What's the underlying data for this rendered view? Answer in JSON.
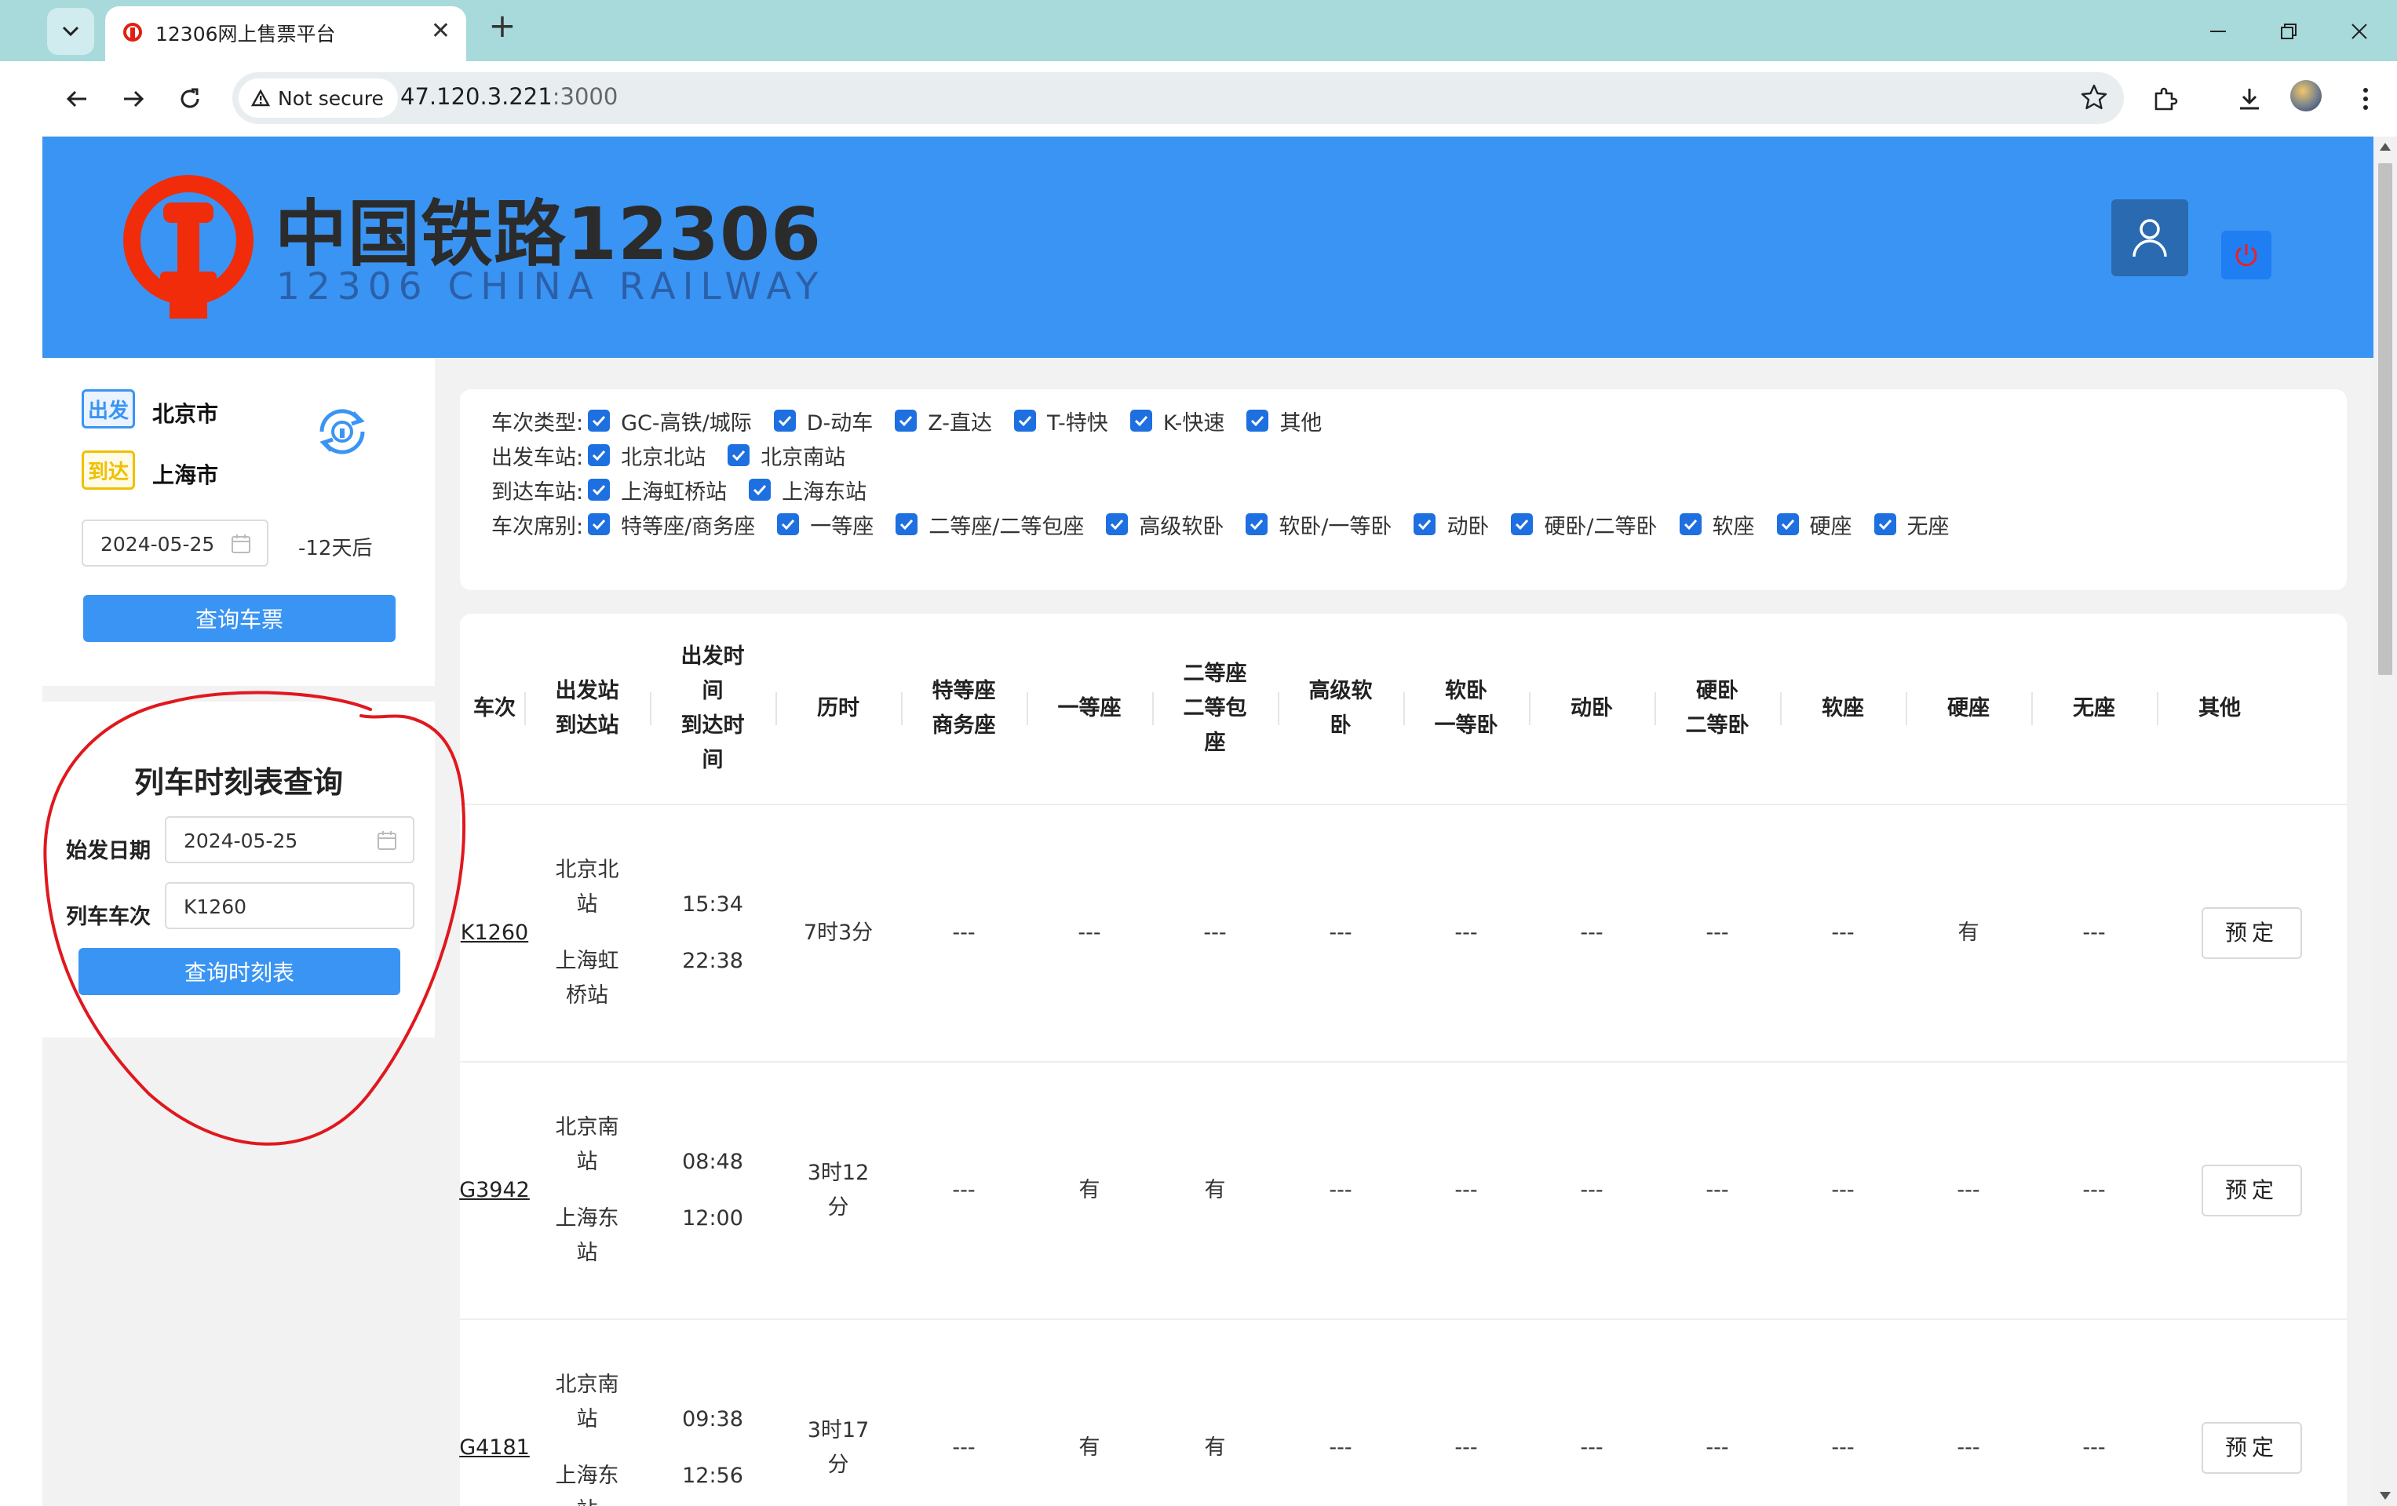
{
  "browser": {
    "tab_title": "12306网上售票平台",
    "security_label": "Not secure",
    "url_host": "47.120.3.221",
    "url_port": ":3000"
  },
  "header": {
    "logo_title": "中国铁路12306",
    "logo_subtitle": "12306 CHINA RAILWAY",
    "brand_color": "#3a94f3"
  },
  "search": {
    "depart_tag": "出发",
    "depart_city": "北京市",
    "arrive_tag": "到达",
    "arrive_city": "上海市",
    "date": "2024-05-25",
    "days_later": "-12天后",
    "query_button": "查询车票"
  },
  "timetable": {
    "title": "列车时刻表查询",
    "date_label": "始发日期",
    "date_value": "2024-05-25",
    "train_label": "列车车次",
    "train_value": "K1260",
    "query_button": "查询时刻表"
  },
  "filters": {
    "train_type_label": "车次类型:",
    "train_types": [
      "GC-高铁/城际",
      "D-动车",
      "Z-直达",
      "T-特快",
      "K-快速",
      "其他"
    ],
    "depart_station_label": "出发车站:",
    "depart_stations": [
      "北京北站",
      "北京南站"
    ],
    "arrive_station_label": "到达车站:",
    "arrive_stations": [
      "上海虹桥站",
      "上海东站"
    ],
    "seat_label": "车次席别:",
    "seats": [
      "特等座/商务座",
      "一等座",
      "二等座/二等包座",
      "高级软卧",
      "软卧/一等卧",
      "动卧",
      "硬卧/二等卧",
      "软座",
      "硬座",
      "无座"
    ]
  },
  "table": {
    "headers": {
      "train_no": "车次",
      "stations_1": "出发站",
      "stations_2": "到达站",
      "time_1": "出发时",
      "time_2": "间",
      "time_3": "到达时",
      "time_4": "间",
      "duration": "历时",
      "business_1": "特等座",
      "business_2": "商务座",
      "first": "一等座",
      "second_1": "二等座",
      "second_2": "二等包",
      "second_3": "座",
      "deluxe_1": "高级软",
      "deluxe_2": "卧",
      "soft_sleeper_1": "软卧",
      "soft_sleeper_2": "一等卧",
      "moving_sleeper": "动卧",
      "hard_sleeper_1": "硬卧",
      "hard_sleeper_2": "二等卧",
      "soft_seat": "软座",
      "hard_seat": "硬座",
      "no_seat": "无座",
      "other": "其他"
    },
    "rows": [
      {
        "train_no": "K1260",
        "from_1": "北京北",
        "from_2": "站",
        "to_1": "上海虹",
        "to_2": "桥站",
        "depart_time": "15:34",
        "arrive_time": "22:38",
        "duration_1": "7时3分",
        "duration_2": "",
        "seats": [
          "---",
          "---",
          "---",
          "---",
          "---",
          "---",
          "---",
          "---",
          "有",
          "---"
        ],
        "book": "预定"
      },
      {
        "train_no": "G3942",
        "from_1": "北京南",
        "from_2": "站",
        "to_1": "上海东",
        "to_2": "站",
        "depart_time": "08:48",
        "arrive_time": "12:00",
        "duration_1": "3时12",
        "duration_2": "分",
        "seats": [
          "---",
          "有",
          "有",
          "---",
          "---",
          "---",
          "---",
          "---",
          "---",
          "---"
        ],
        "book": "预定"
      },
      {
        "train_no": "G4181",
        "from_1": "北京南",
        "from_2": "站",
        "to_1": "上海东",
        "to_2": "站",
        "depart_time": "09:38",
        "arrive_time": "12:56",
        "duration_1": "3时17",
        "duration_2": "分",
        "seats": [
          "---",
          "有",
          "有",
          "---",
          "---",
          "---",
          "---",
          "---",
          "---",
          "---"
        ],
        "book": "预定"
      }
    ]
  }
}
